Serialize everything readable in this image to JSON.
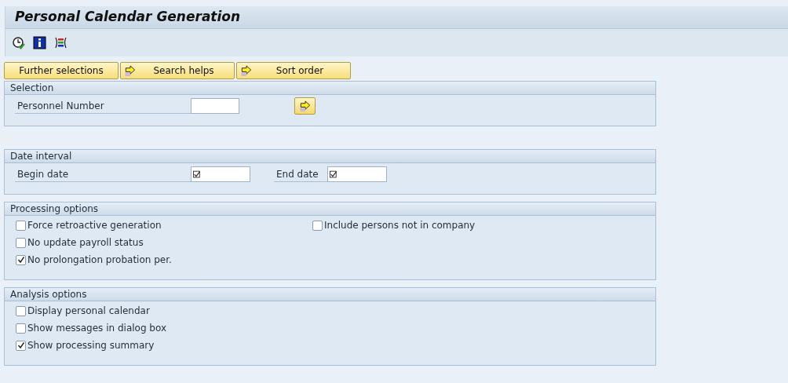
{
  "window": {
    "title": "Personal Calendar Generation"
  },
  "toolbar": {
    "icons": [
      {
        "kind": "clock"
      },
      {
        "kind": "info"
      },
      {
        "kind": "list"
      }
    ]
  },
  "tab_buttons": [
    {
      "label": "Further selections",
      "has_icon": false
    },
    {
      "label": "Search helps",
      "has_icon": true
    },
    {
      "label": "Sort order",
      "has_icon": true
    }
  ],
  "selection": {
    "title": "Selection",
    "fields": [
      {
        "label": "Personnel Number",
        "required": false
      }
    ]
  },
  "date_interval": {
    "title": "Date interval",
    "fields": [
      {
        "label": "Begin date",
        "required": true
      },
      {
        "label": "End date",
        "required": true
      }
    ]
  },
  "processing_options": {
    "title": "Processing options",
    "columns": [
      [
        {
          "label": "Force retroactive generation",
          "checked": false
        },
        {
          "label": "No update payroll status",
          "checked": false
        },
        {
          "label": "No prolongation probation per.",
          "checked": true
        }
      ],
      [
        {
          "label": "Include persons not in company",
          "checked": false
        }
      ]
    ]
  },
  "analysis_options": {
    "title": "Analysis options",
    "columns": [
      [
        {
          "label": "Display personal calendar",
          "checked": false
        },
        {
          "label": "Show messages in dialog box",
          "checked": false
        },
        {
          "label": "Show processing summary",
          "checked": true
        }
      ]
    ]
  }
}
